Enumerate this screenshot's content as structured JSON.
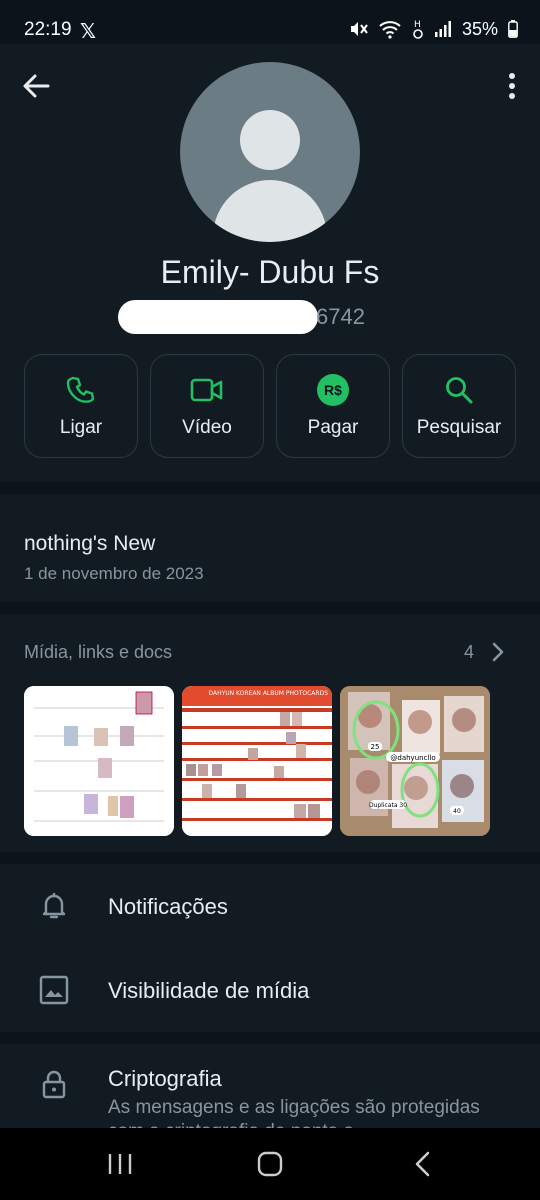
{
  "status_bar": {
    "time": "22:19",
    "x_logo": "𝕏",
    "battery": "35%"
  },
  "contact": {
    "name": "Emily- Dubu Fs",
    "phone_suffix": "6742"
  },
  "actions": [
    {
      "label": "Ligar",
      "icon": "phone-icon"
    },
    {
      "label": "Vídeo",
      "icon": "video-icon"
    },
    {
      "label": "Pagar",
      "icon": "pay-icon",
      "badge": "R$"
    },
    {
      "label": "Pesquisar",
      "icon": "search-icon"
    }
  ],
  "about": {
    "text": "nothing's New",
    "date": "1 de novembro de 2023"
  },
  "media": {
    "title": "Mídia, links e docs",
    "count": "4",
    "thumb_overlay_text": {
      "tag_25": "25",
      "handle": "@dahyuncllo",
      "duplicata": "Duplicata 30",
      "tag_40": "40",
      "banner": "DAHYUN KOREAN ALBUM PHOTOCARDS"
    }
  },
  "settings": [
    {
      "label": "Notificações",
      "icon": "bell-icon"
    },
    {
      "label": "Visibilidade de mídia",
      "icon": "image-icon"
    }
  ],
  "encryption": {
    "label": "Criptografia",
    "sub": "As mensagens e as ligações são protegidas com a criptografia de ponta a"
  },
  "colors": {
    "accent": "#21c063",
    "background": "#0b141a",
    "surface": "#121b22"
  }
}
